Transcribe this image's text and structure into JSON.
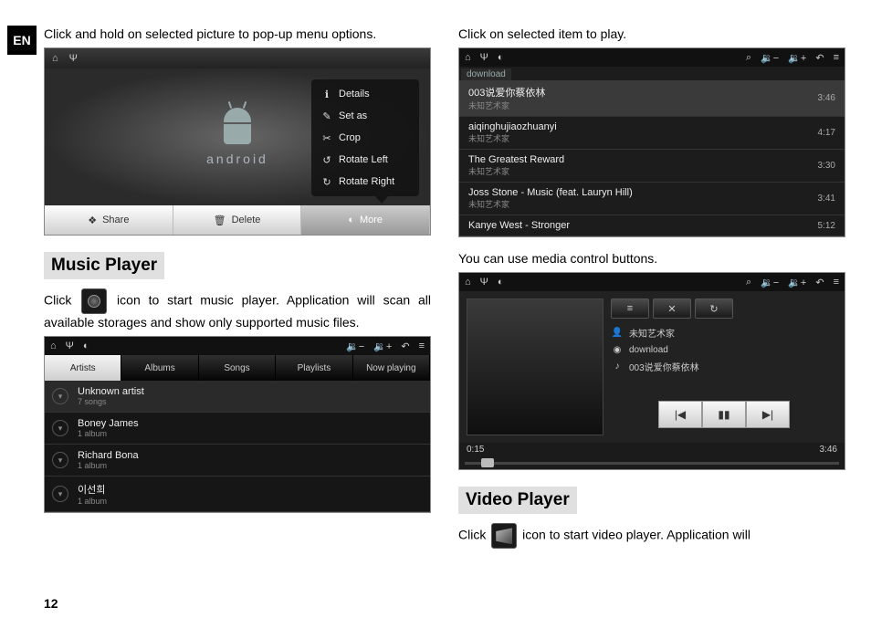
{
  "lang_tab": "EN",
  "page_number": "12",
  "left": {
    "intro1": "Click and hold on selected picture to pop-up menu options.",
    "music_header": "Music Player",
    "music_text_a": "Click ",
    "music_text_b": " icon to start music player. Application will scan all available storages and show only supported music files."
  },
  "right": {
    "intro2": "Click on selected item to play.",
    "media_hint": "You can use media control buttons.",
    "video_header": "Video Player",
    "video_text_a": "Click ",
    "video_text_b": " icon to start video player. Application will"
  },
  "gallery": {
    "android_label": "android",
    "menu": [
      {
        "icon": "ℹ",
        "label": "Details"
      },
      {
        "icon": "✎",
        "label": "Set as"
      },
      {
        "icon": "✂",
        "label": "Crop"
      },
      {
        "icon": "↺",
        "label": "Rotate Left"
      },
      {
        "icon": "↻",
        "label": "Rotate Right"
      }
    ],
    "bottom": {
      "share": "Share",
      "delete": "Delete",
      "more": "More"
    }
  },
  "status_icons": {
    "home": "⌂",
    "usb": "Ψ",
    "droid": "◐",
    "search": "⌕",
    "vol_dn": "🔉−",
    "vol_up": "🔉+",
    "back": "↶",
    "list": "≡"
  },
  "music_tabs": [
    {
      "label": "Artists",
      "selected": true
    },
    {
      "label": "Albums"
    },
    {
      "label": "Songs"
    },
    {
      "label": "Playlists"
    },
    {
      "label": "Now playing"
    }
  ],
  "artists": [
    {
      "name": "Unknown artist",
      "sub": "7 songs",
      "hl": true
    },
    {
      "name": "Boney James",
      "sub": "1 album"
    },
    {
      "name": "Richard Bona",
      "sub": "1 album"
    },
    {
      "name": "이선희",
      "sub": "1 album"
    }
  ],
  "tracklist": {
    "tag": "download",
    "tracks": [
      {
        "title": "003说爱你蔡依林",
        "artist": "未知艺术家",
        "dur": "3:46",
        "hl": true
      },
      {
        "title": "aiqinghujiaozhuanyi",
        "artist": "未知艺术家",
        "dur": "4:17"
      },
      {
        "title": "The Greatest Reward",
        "artist": "未知艺术家",
        "dur": "3:30"
      },
      {
        "title": "Joss Stone - Music (feat. Lauryn Hill)",
        "artist": "未知艺术家",
        "dur": "3:41"
      },
      {
        "title": "Kanye West - Stronger",
        "artist": "",
        "dur": "5:12"
      }
    ]
  },
  "nowplaying": {
    "buttons": {
      "list": "≡",
      "shuffle": "✕",
      "repeat": "↻"
    },
    "meta_artist": "未知艺术家",
    "meta_folder": "download",
    "meta_track": "003说爱你蔡依林",
    "transport": {
      "prev": "|◀",
      "pause": "▮▮",
      "next": "▶|"
    },
    "elapsed": "0:15",
    "total": "3:46"
  }
}
